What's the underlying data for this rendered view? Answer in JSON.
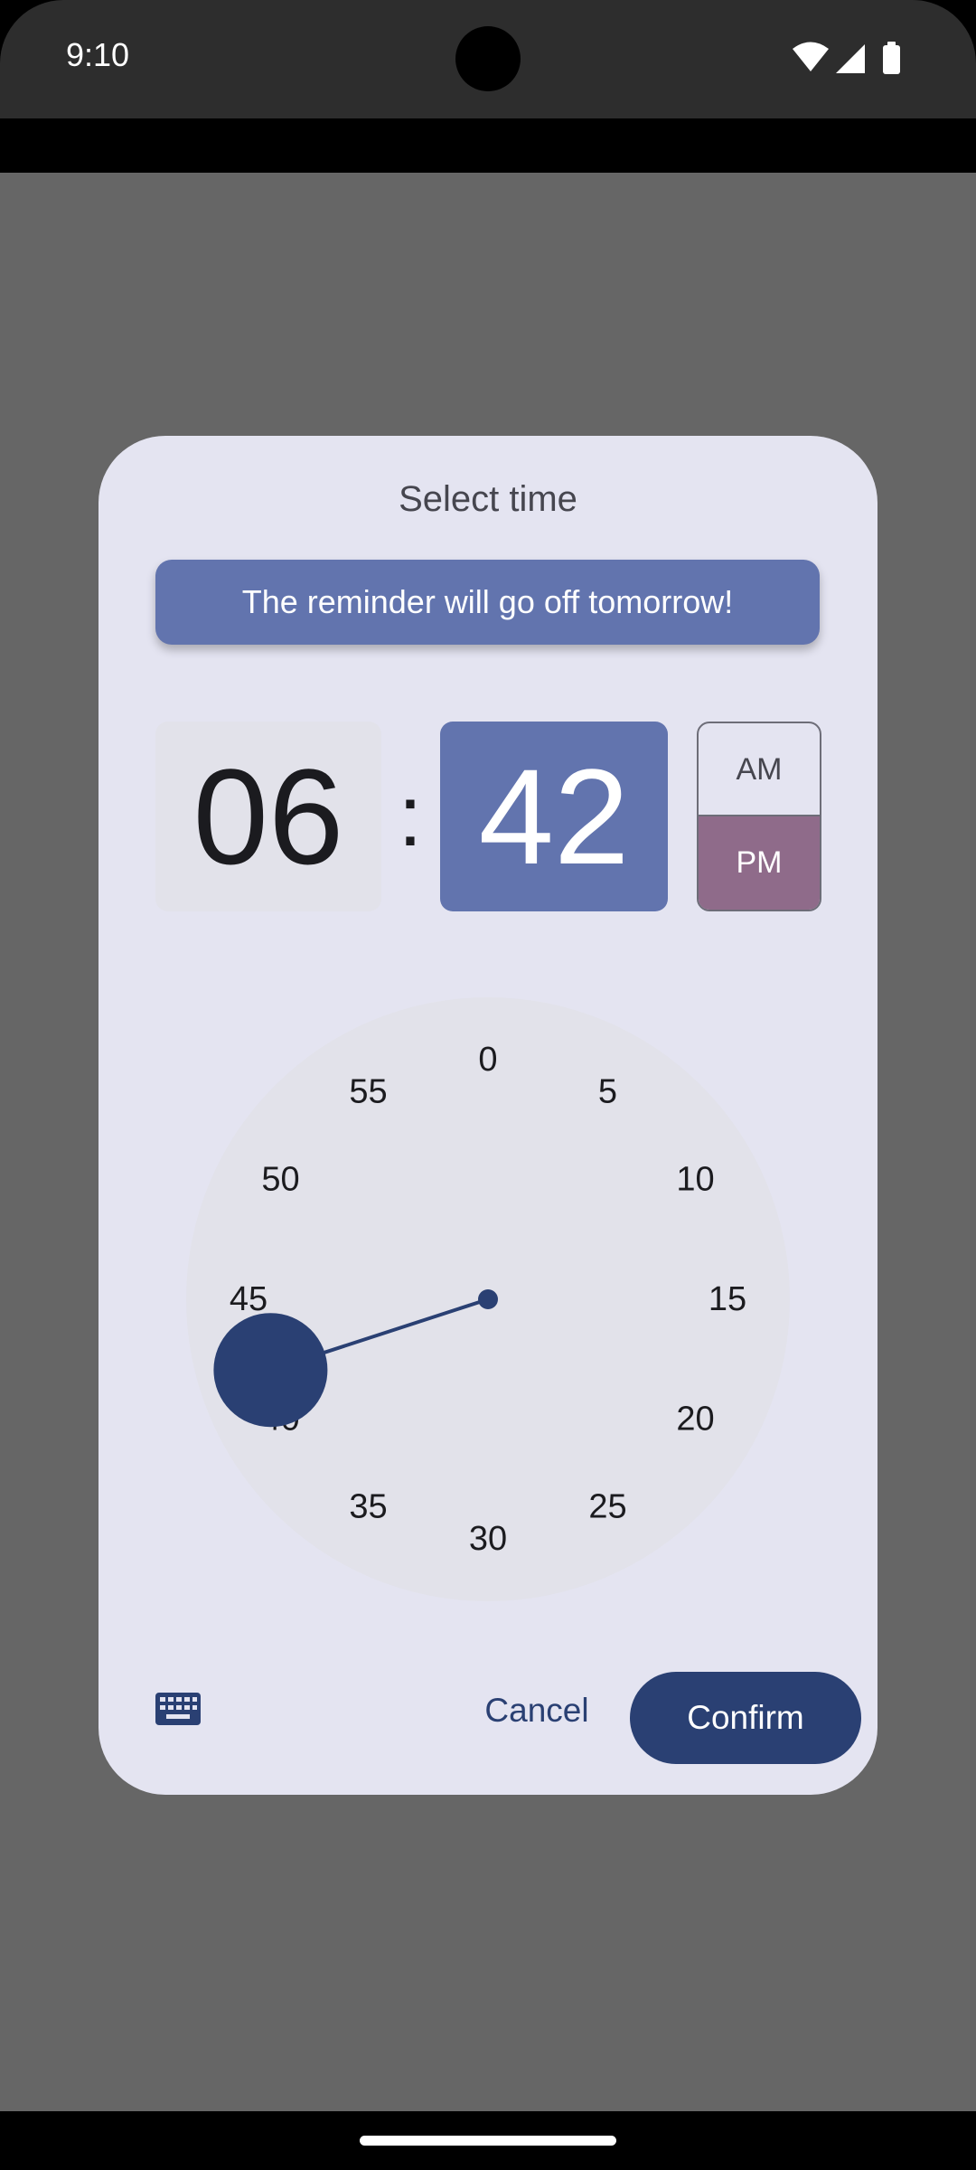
{
  "status_bar": {
    "time": "9:10",
    "icons": [
      "wifi-icon",
      "cellular-signal-icon",
      "battery-icon"
    ]
  },
  "dialog": {
    "title": "Select time",
    "banner_text": "The reminder will go off tomorrow!",
    "hour": "06",
    "separator": ":",
    "minute": "42",
    "am_label": "AM",
    "pm_label": "PM",
    "selected_period": "PM",
    "clock_numbers": [
      "0",
      "5",
      "10",
      "15",
      "20",
      "25",
      "30",
      "35",
      "40",
      "45",
      "50",
      "55"
    ],
    "selected_minute_value": 42,
    "keyboard_icon": "keyboard-icon",
    "cancel_label": "Cancel",
    "confirm_label": "Confirm"
  },
  "colors": {
    "scrim": "#666666",
    "dialog_bg": "#e4e4f1",
    "accent": "#6274ae",
    "primary": "#2a4073",
    "pm_selected": "#8f6b8a",
    "clock_bg": "#e2e2ea"
  }
}
